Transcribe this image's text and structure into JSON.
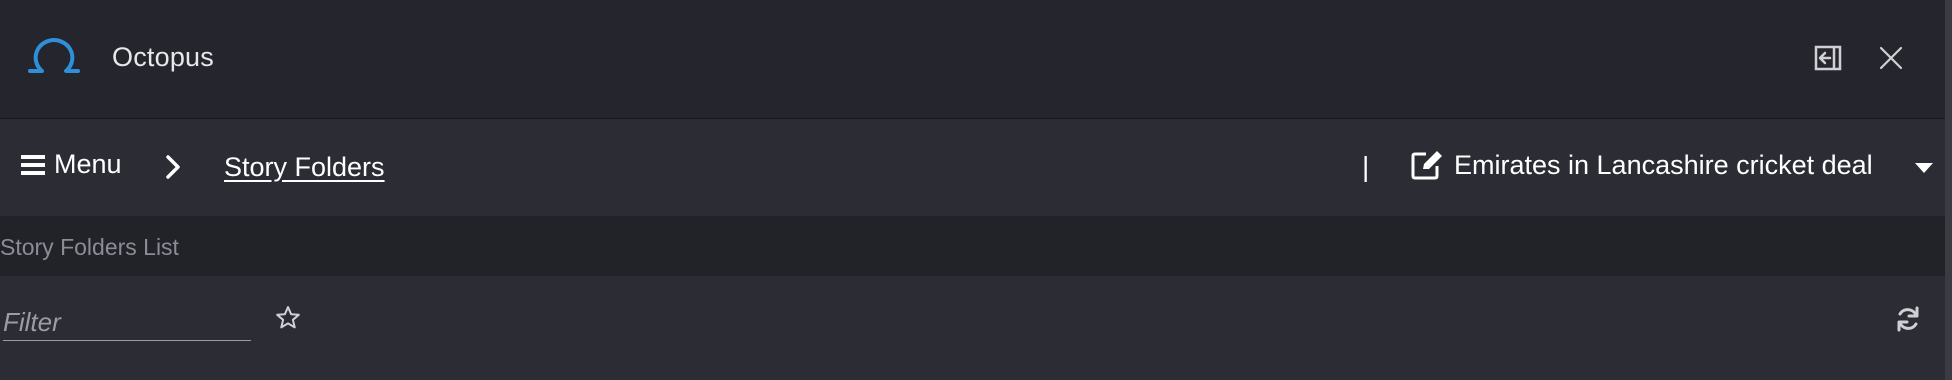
{
  "window": {
    "title": "Octopus",
    "logo_icon": "omega-logo-icon",
    "collapse_icon": "collapse-panel-icon",
    "close_icon": "close-icon"
  },
  "nav": {
    "menu_label": "Menu",
    "menu_icon": "hamburger-icon",
    "breadcrumb_separator_icon": "chevron-right-icon",
    "breadcrumb_current": "Story Folders",
    "divider": "|",
    "story_icon": "edit-icon",
    "story_title": "Emirates in Lancashire cricket deal",
    "story_dropdown_icon": "caret-down-icon"
  },
  "section": {
    "title": "Story Folders List"
  },
  "filter": {
    "placeholder": "Filter",
    "value": "",
    "favorite_icon": "star-outline-icon",
    "refresh_icon": "refresh-icon"
  },
  "colors": {
    "accent": "#2f8fd8",
    "titlebar_bg": "#25262d",
    "panel_bg": "#2b2c34",
    "section_bg": "#222328",
    "muted_text": "#8a8c96"
  }
}
